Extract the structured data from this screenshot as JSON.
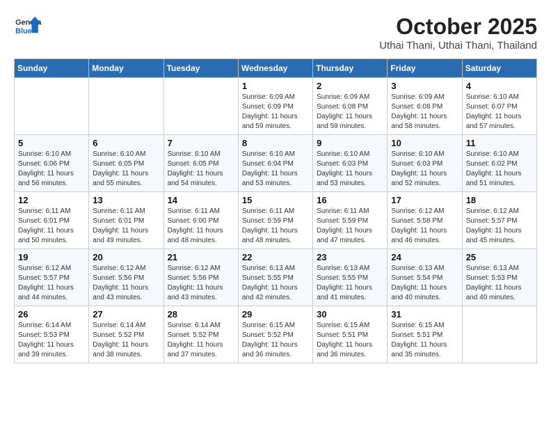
{
  "header": {
    "logo_general": "General",
    "logo_blue": "Blue",
    "month": "October 2025",
    "location": "Uthai Thani, Uthai Thani, Thailand"
  },
  "weekdays": [
    "Sunday",
    "Monday",
    "Tuesday",
    "Wednesday",
    "Thursday",
    "Friday",
    "Saturday"
  ],
  "weeks": [
    [
      {
        "day": "",
        "info": ""
      },
      {
        "day": "",
        "info": ""
      },
      {
        "day": "",
        "info": ""
      },
      {
        "day": "1",
        "info": "Sunrise: 6:09 AM\nSunset: 6:09 PM\nDaylight: 11 hours\nand 59 minutes."
      },
      {
        "day": "2",
        "info": "Sunrise: 6:09 AM\nSunset: 6:08 PM\nDaylight: 11 hours\nand 59 minutes."
      },
      {
        "day": "3",
        "info": "Sunrise: 6:09 AM\nSunset: 6:08 PM\nDaylight: 11 hours\nand 58 minutes."
      },
      {
        "day": "4",
        "info": "Sunrise: 6:10 AM\nSunset: 6:07 PM\nDaylight: 11 hours\nand 57 minutes."
      }
    ],
    [
      {
        "day": "5",
        "info": "Sunrise: 6:10 AM\nSunset: 6:06 PM\nDaylight: 11 hours\nand 56 minutes."
      },
      {
        "day": "6",
        "info": "Sunrise: 6:10 AM\nSunset: 6:05 PM\nDaylight: 11 hours\nand 55 minutes."
      },
      {
        "day": "7",
        "info": "Sunrise: 6:10 AM\nSunset: 6:05 PM\nDaylight: 11 hours\nand 54 minutes."
      },
      {
        "day": "8",
        "info": "Sunrise: 6:10 AM\nSunset: 6:04 PM\nDaylight: 11 hours\nand 53 minutes."
      },
      {
        "day": "9",
        "info": "Sunrise: 6:10 AM\nSunset: 6:03 PM\nDaylight: 11 hours\nand 53 minutes."
      },
      {
        "day": "10",
        "info": "Sunrise: 6:10 AM\nSunset: 6:03 PM\nDaylight: 11 hours\nand 52 minutes."
      },
      {
        "day": "11",
        "info": "Sunrise: 6:10 AM\nSunset: 6:02 PM\nDaylight: 11 hours\nand 51 minutes."
      }
    ],
    [
      {
        "day": "12",
        "info": "Sunrise: 6:11 AM\nSunset: 6:01 PM\nDaylight: 11 hours\nand 50 minutes."
      },
      {
        "day": "13",
        "info": "Sunrise: 6:11 AM\nSunset: 6:01 PM\nDaylight: 11 hours\nand 49 minutes."
      },
      {
        "day": "14",
        "info": "Sunrise: 6:11 AM\nSunset: 6:00 PM\nDaylight: 11 hours\nand 48 minutes."
      },
      {
        "day": "15",
        "info": "Sunrise: 6:11 AM\nSunset: 5:59 PM\nDaylight: 11 hours\nand 48 minutes."
      },
      {
        "day": "16",
        "info": "Sunrise: 6:11 AM\nSunset: 5:59 PM\nDaylight: 11 hours\nand 47 minutes."
      },
      {
        "day": "17",
        "info": "Sunrise: 6:12 AM\nSunset: 5:58 PM\nDaylight: 11 hours\nand 46 minutes."
      },
      {
        "day": "18",
        "info": "Sunrise: 6:12 AM\nSunset: 5:57 PM\nDaylight: 11 hours\nand 45 minutes."
      }
    ],
    [
      {
        "day": "19",
        "info": "Sunrise: 6:12 AM\nSunset: 5:57 PM\nDaylight: 11 hours\nand 44 minutes."
      },
      {
        "day": "20",
        "info": "Sunrise: 6:12 AM\nSunset: 5:56 PM\nDaylight: 11 hours\nand 43 minutes."
      },
      {
        "day": "21",
        "info": "Sunrise: 6:12 AM\nSunset: 5:56 PM\nDaylight: 11 hours\nand 43 minutes."
      },
      {
        "day": "22",
        "info": "Sunrise: 6:13 AM\nSunset: 5:55 PM\nDaylight: 11 hours\nand 42 minutes."
      },
      {
        "day": "23",
        "info": "Sunrise: 6:13 AM\nSunset: 5:55 PM\nDaylight: 11 hours\nand 41 minutes."
      },
      {
        "day": "24",
        "info": "Sunrise: 6:13 AM\nSunset: 5:54 PM\nDaylight: 11 hours\nand 40 minutes."
      },
      {
        "day": "25",
        "info": "Sunrise: 6:13 AM\nSunset: 5:53 PM\nDaylight: 11 hours\nand 40 minutes."
      }
    ],
    [
      {
        "day": "26",
        "info": "Sunrise: 6:14 AM\nSunset: 5:53 PM\nDaylight: 11 hours\nand 39 minutes."
      },
      {
        "day": "27",
        "info": "Sunrise: 6:14 AM\nSunset: 5:52 PM\nDaylight: 11 hours\nand 38 minutes."
      },
      {
        "day": "28",
        "info": "Sunrise: 6:14 AM\nSunset: 5:52 PM\nDaylight: 11 hours\nand 37 minutes."
      },
      {
        "day": "29",
        "info": "Sunrise: 6:15 AM\nSunset: 5:52 PM\nDaylight: 11 hours\nand 36 minutes."
      },
      {
        "day": "30",
        "info": "Sunrise: 6:15 AM\nSunset: 5:51 PM\nDaylight: 11 hours\nand 36 minutes."
      },
      {
        "day": "31",
        "info": "Sunrise: 6:15 AM\nSunset: 5:51 PM\nDaylight: 11 hours\nand 35 minutes."
      },
      {
        "day": "",
        "info": ""
      }
    ]
  ]
}
